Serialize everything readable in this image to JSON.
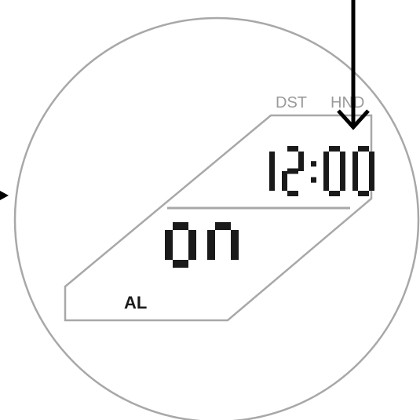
{
  "indicators": {
    "dst": "DST",
    "hnd": "HND"
  },
  "display": {
    "time": "12:00",
    "alarm_state": "ON",
    "mode_label": "AL"
  },
  "colors": {
    "outline": "#a8a8a8",
    "segment": "#1a1a1a",
    "arrow": "#000000",
    "indicator_text": "#9a9a9a"
  },
  "annotations": {
    "top_arrow": "arrow-down-icon",
    "left_arrow": "arrow-right-icon"
  }
}
